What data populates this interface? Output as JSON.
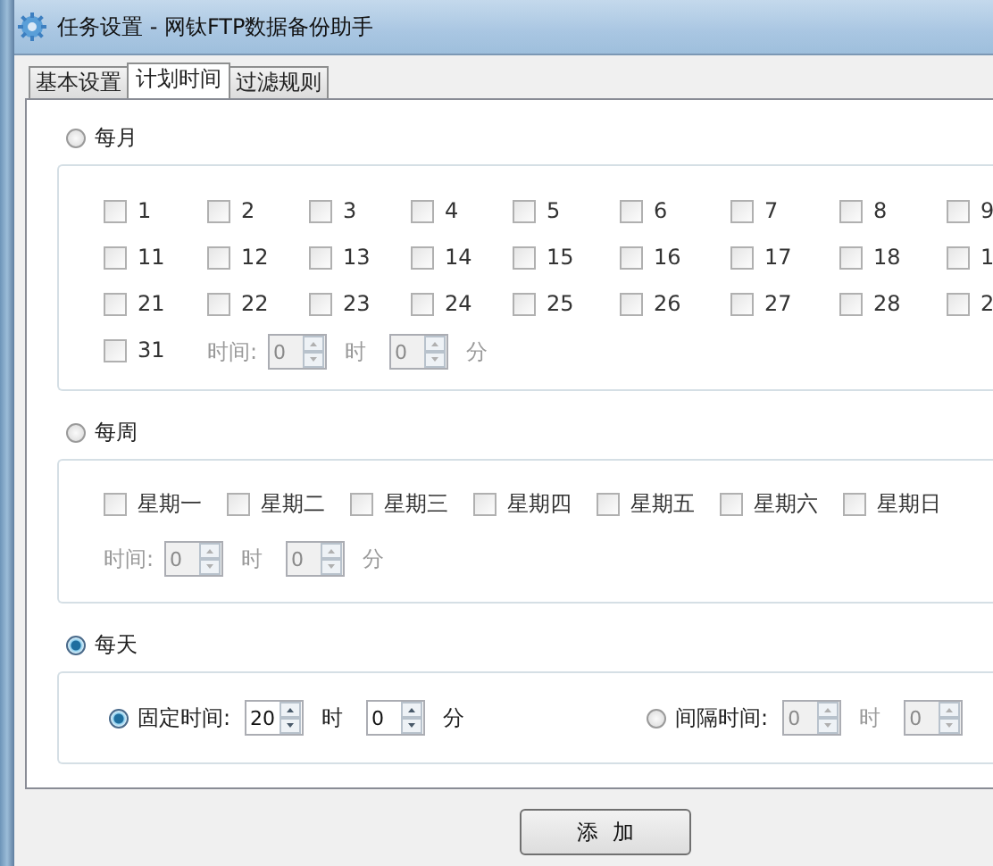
{
  "window": {
    "title": "任务设置 - 网钛FTP数据备份助手"
  },
  "tabs": [
    {
      "label": "基本设置",
      "selected": false
    },
    {
      "label": "计划时间",
      "selected": true
    },
    {
      "label": "过滤规则",
      "selected": false
    }
  ],
  "monthly": {
    "label": "每月",
    "selected": false,
    "days": [
      {
        "label": "1",
        "checked": false
      },
      {
        "label": "2",
        "checked": false
      },
      {
        "label": "3",
        "checked": false
      },
      {
        "label": "4",
        "checked": false
      },
      {
        "label": "5",
        "checked": false
      },
      {
        "label": "6",
        "checked": false
      },
      {
        "label": "7",
        "checked": false
      },
      {
        "label": "8",
        "checked": false
      },
      {
        "label": "9",
        "checked": false
      },
      {
        "label": "11",
        "checked": false
      },
      {
        "label": "12",
        "checked": false
      },
      {
        "label": "13",
        "checked": false
      },
      {
        "label": "14",
        "checked": false
      },
      {
        "label": "15",
        "checked": false
      },
      {
        "label": "16",
        "checked": false
      },
      {
        "label": "17",
        "checked": false
      },
      {
        "label": "18",
        "checked": false
      },
      {
        "label": "1",
        "checked": false
      },
      {
        "label": "21",
        "checked": false
      },
      {
        "label": "22",
        "checked": false
      },
      {
        "label": "23",
        "checked": false
      },
      {
        "label": "24",
        "checked": false
      },
      {
        "label": "25",
        "checked": false
      },
      {
        "label": "26",
        "checked": false
      },
      {
        "label": "27",
        "checked": false
      },
      {
        "label": "28",
        "checked": false
      },
      {
        "label": "2",
        "checked": false
      },
      {
        "label": "31",
        "checked": false
      }
    ],
    "time": {
      "label": "时间:",
      "disabled": true,
      "hour": "0",
      "hour_unit": "时",
      "minute": "0",
      "minute_unit": "分"
    }
  },
  "weekly": {
    "label": "每周",
    "selected": false,
    "days": [
      {
        "label": "星期一",
        "checked": false
      },
      {
        "label": "星期二",
        "checked": false
      },
      {
        "label": "星期三",
        "checked": false
      },
      {
        "label": "星期四",
        "checked": false
      },
      {
        "label": "星期五",
        "checked": false
      },
      {
        "label": "星期六",
        "checked": false
      },
      {
        "label": "星期日",
        "checked": false
      }
    ],
    "time": {
      "label": "时间:",
      "disabled": true,
      "hour": "0",
      "hour_unit": "时",
      "minute": "0",
      "minute_unit": "分"
    }
  },
  "daily": {
    "label": "每天",
    "selected": true,
    "fixed": {
      "label": "固定时间:",
      "selected": true,
      "disabled": false,
      "hour": "20",
      "hour_unit": "时",
      "minute": "0",
      "minute_unit": "分"
    },
    "interval": {
      "label": "间隔时间:",
      "selected": false,
      "disabled": true,
      "hour": "0",
      "hour_unit": "时",
      "minute": "0"
    }
  },
  "button": "添  加"
}
